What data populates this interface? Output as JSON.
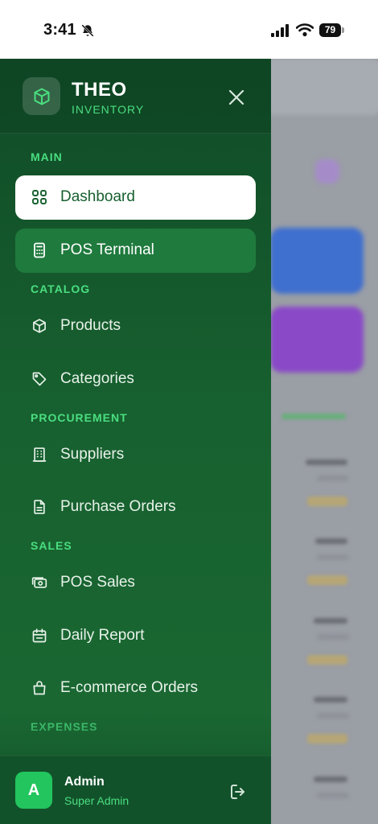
{
  "status_bar": {
    "time": "3:41",
    "battery": "79"
  },
  "drawer": {
    "brand": {
      "name": "THEO",
      "subtitle": "INVENTORY"
    },
    "sections": {
      "main": "MAIN",
      "catalog": "CATALOG",
      "procurement": "PROCUREMENT",
      "sales": "SALES",
      "expenses": "EXPENSES"
    },
    "items": {
      "dashboard": "Dashboard",
      "pos_terminal": "POS Terminal",
      "products": "Products",
      "categories": "Categories",
      "suppliers": "Suppliers",
      "purchase_orders": "Purchase Orders",
      "pos_sales": "POS Sales",
      "daily_report": "Daily Report",
      "ecommerce_orders": "E-commerce Orders"
    },
    "user": {
      "initial": "A",
      "name": "Admin",
      "role": "Super Admin"
    }
  },
  "colors": {
    "drawer_dark": "#104b27",
    "drawer_light": "#1b6a33",
    "accent": "#4ade80",
    "active_bg": "#ffffff",
    "highlight_bg": "#1f7a3d",
    "avatar_bg": "#22c55e"
  },
  "icons": {
    "brand": "box-icon",
    "close": "close-icon",
    "dashboard": "grid-icon",
    "pos_terminal": "calculator-icon",
    "products": "package-icon",
    "categories": "tag-icon",
    "suppliers": "building-icon",
    "purchase_orders": "document-icon",
    "pos_sales": "cash-icon",
    "daily_report": "calendar-icon",
    "ecommerce_orders": "shopping-bag-icon",
    "logout": "logout-icon"
  }
}
